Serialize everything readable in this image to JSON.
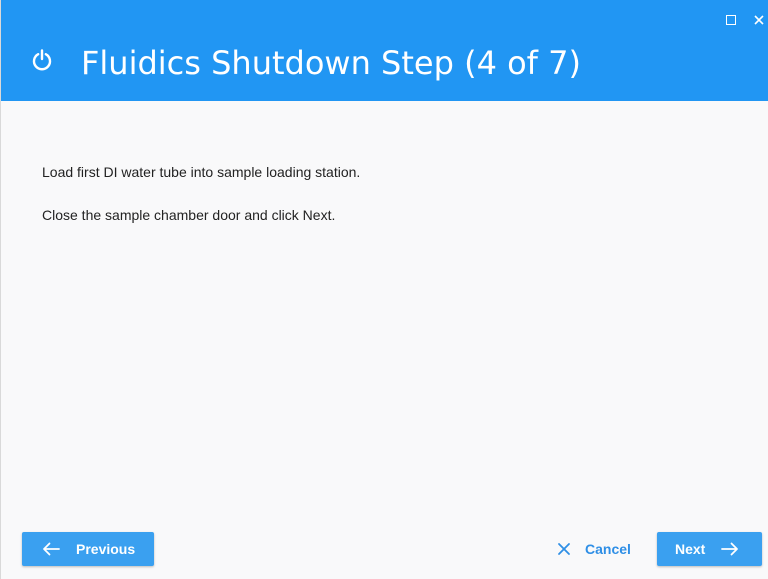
{
  "window": {
    "controls": {
      "maximize_icon": "maximize-icon",
      "close_icon": "close-icon"
    }
  },
  "header": {
    "icon": "power-icon",
    "title": "Fluidics Shutdown Step (4 of 7)",
    "background_color": "#2196f3"
  },
  "content": {
    "instructions": [
      "Load first DI water tube into sample loading station.",
      "Close the sample chamber door and click Next."
    ]
  },
  "footer": {
    "previous_label": "Previous",
    "cancel_label": "Cancel",
    "next_label": "Next",
    "button_color": "#3aa0f0",
    "cancel_color": "#2f8fe6"
  }
}
